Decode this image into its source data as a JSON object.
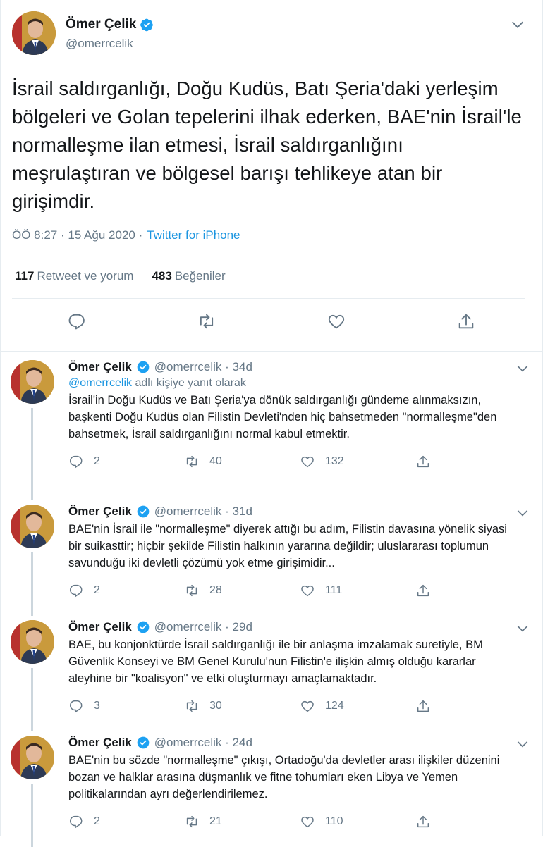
{
  "main_tweet": {
    "author_name": "Ömer Çelik",
    "handle": "@omerrcelik",
    "text": "İsrail saldırganlığı, Doğu Kudüs, Batı Şeria'daki yerleşim bölgeleri ve Golan tepelerini ilhak ederken, BAE'nin İsrail'le normalleşme ilan etmesi, İsrail saldırganlığını meşrulaştıran ve bölgesel barışı tehlikeye atan bir girişimdir.",
    "time": "ÖÖ 8:27 · 15 Ağu 2020 ·",
    "source": "Twitter for iPhone",
    "retweets_count": "117",
    "retweets_label": "Retweet ve yorum",
    "likes_count": "483",
    "likes_label": "Beğeniler"
  },
  "replies": [
    {
      "author_name": "Ömer Çelik",
      "meta": "@omerrcelik · 34d",
      "replying_prefix": "@omerrcelik",
      "replying_suffix": "adlı kişiye yanıt olarak",
      "text": "İsrail'in Doğu Kudüs ve Batı Şeria'ya dönük saldırganlığı gündeme alınmaksızın, başkenti Doğu Kudüs olan Filistin Devleti'nden hiç bahsetmeden \"normalleşme\"den bahsetmek, İsrail saldırganlığını normal kabul etmektir.",
      "replies": "2",
      "retweets": "40",
      "likes": "132"
    },
    {
      "author_name": "Ömer Çelik",
      "meta": "@omerrcelik · 31d",
      "text": "BAE'nin İsrail ile \"normalleşme\" diyerek attığı bu adım, Filistin davasına yönelik siyasi bir suikasttir; hiçbir şekilde Filistin halkının yararına değildir; uluslararası toplumun savunduğu iki devletli çözümü yok etme girişimidir...",
      "replies": "2",
      "retweets": "28",
      "likes": "111"
    },
    {
      "author_name": "Ömer Çelik",
      "meta": "@omerrcelik · 29d",
      "text": "BAE, bu konjonktürde İsrail saldırganlığı ile bir anlaşma imzalamak suretiyle, BM Güvenlik Konseyi ve BM Genel Kurulu'nun Filistin'e ilişkin almış olduğu kararlar aleyhine bir \"koalisyon\" ve etki oluşturmayı amaçlamaktadır.",
      "replies": "3",
      "retweets": "30",
      "likes": "124"
    },
    {
      "author_name": "Ömer Çelik",
      "meta": "@omerrcelik · 24d",
      "text": "BAE'nin bu sözde \"normalleşme\" çıkışı, Ortadoğu'da devletler arası ilişkiler düzenini bozan ve halklar arasına düşmanlık ve fitne tohumları eken Libya ve Yemen politikalarından ayrı değerlendirilemez.",
      "replies": "2",
      "retweets": "21",
      "likes": "110"
    }
  ],
  "colors": {
    "accent": "#1da1f2",
    "secondary_text": "#657786",
    "border": "#e6ecf0",
    "thread_line": "#ccd6dd"
  },
  "icons": [
    "verified-badge-icon",
    "chevron-down-icon",
    "reply-icon",
    "retweet-icon",
    "like-icon",
    "share-icon"
  ]
}
